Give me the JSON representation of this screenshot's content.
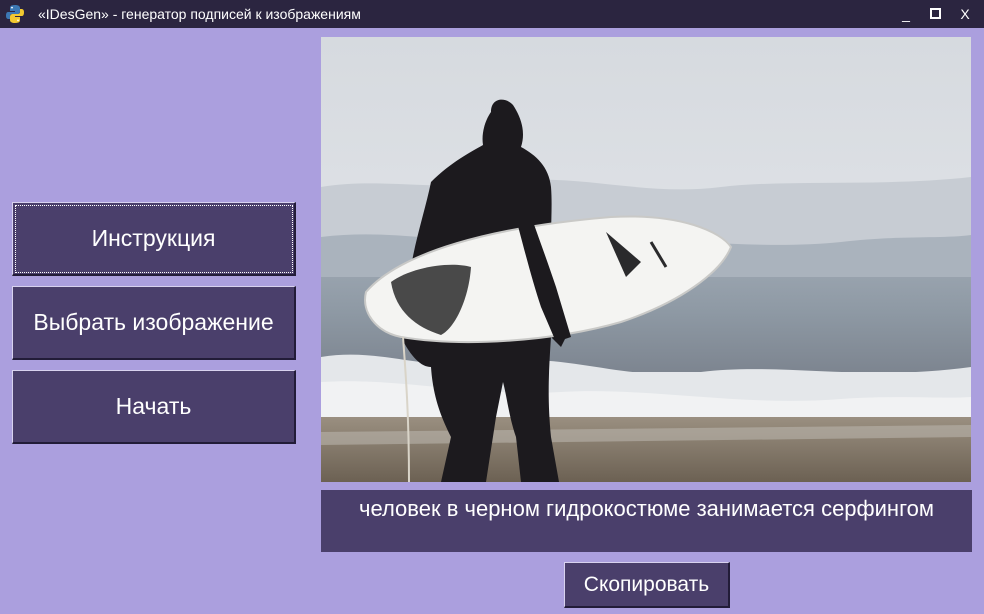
{
  "window": {
    "title": "«IDesGen» - генератор подписей к изображениям",
    "icon": "python-icon",
    "minimize_label": "_",
    "close_label": "X"
  },
  "sidebar": {
    "buttons": [
      {
        "label": "Инструкция",
        "focused": true
      },
      {
        "label": "Выбрать изображение"
      },
      {
        "label": "Начать"
      }
    ]
  },
  "main": {
    "image": "surfer-photo",
    "caption": "человек в черном гидрокостюме занимается серфингом",
    "copy_label": "Скопировать"
  },
  "colors": {
    "background": "#ab9fde",
    "titlebar": "#2b2540",
    "button": "#4a3f6b",
    "text": "#ffffff"
  }
}
